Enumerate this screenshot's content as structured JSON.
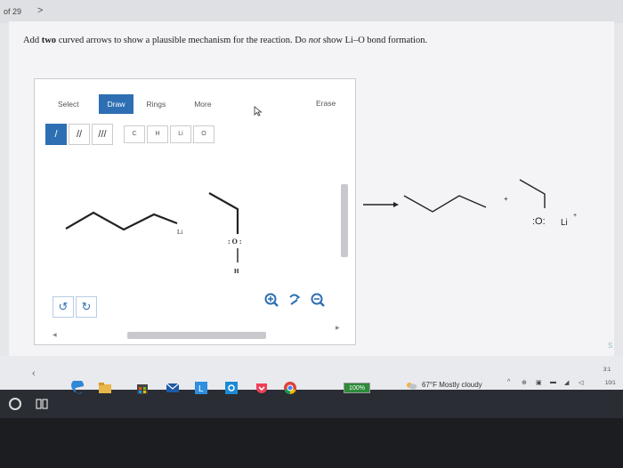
{
  "nav": {
    "page_counter": "of 29",
    "next": ">"
  },
  "question": {
    "part1": "Add ",
    "bold": "two",
    "part2": " curved arrows to show a plausible mechanism for the reaction. Do ",
    "italic": "not",
    "part3": " show Li–O bond formation."
  },
  "toolbar": {
    "tabs": [
      "Select",
      "Draw",
      "Rings",
      "More"
    ],
    "active_tab": "Draw",
    "erase": "Erase",
    "bonds": [
      "/",
      "//",
      "///"
    ],
    "atoms": [
      "C",
      "H",
      "Li",
      "O"
    ]
  },
  "canvas": {
    "li_label": "Li",
    "o_label": ": O :",
    "h_label": "H"
  },
  "products": {
    "plus": "+",
    "alkoxide": ":O:",
    "cation": "Li",
    "cation_charge": "+"
  },
  "status": {
    "zoom": "100%",
    "weather": "67°F  Mostly cloudy",
    "time": "3:1",
    "date": "10/1",
    "side_s": "S"
  },
  "colors": {
    "accent": "#2e6fb3",
    "zoom_badge": "#2e8b3a"
  }
}
